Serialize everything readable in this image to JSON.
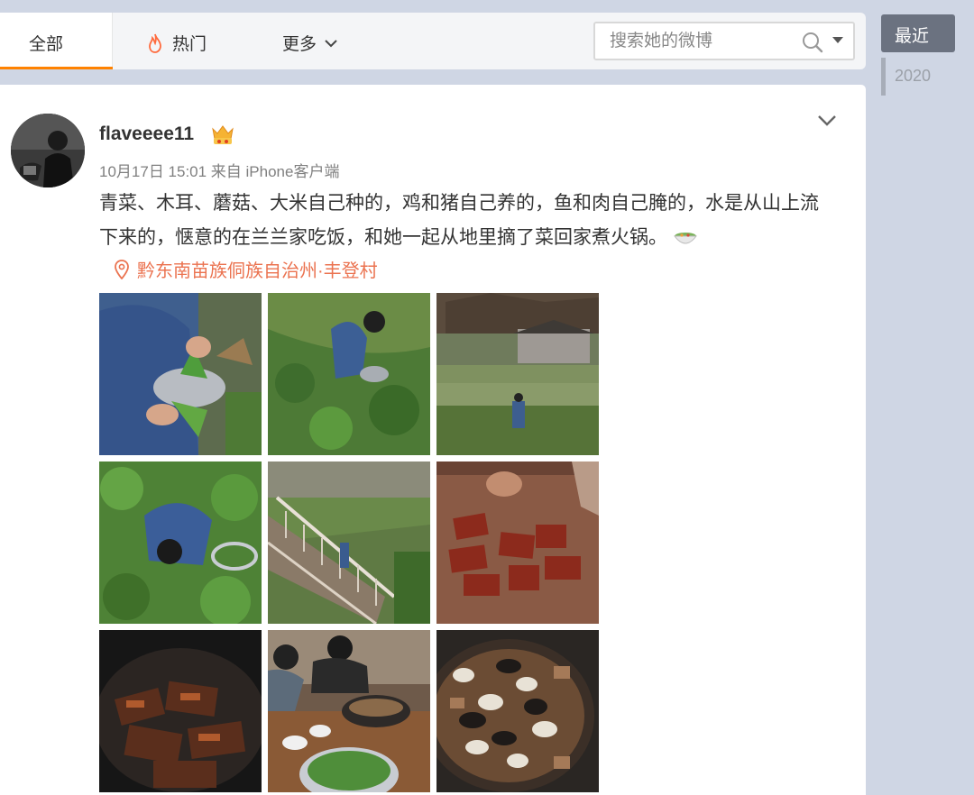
{
  "tabs": {
    "all_label": "全部",
    "hot_label": "热门",
    "more_label": "更多"
  },
  "search": {
    "placeholder": "搜索她的微博"
  },
  "timeline": {
    "current_label": "最近",
    "year": "2020"
  },
  "post": {
    "username": "flaveeee11",
    "meta": "10月17日 15:01 来自 iPhone客户端",
    "content": "青菜、木耳、蘑菇、大米自己种的，鸡和猪自己养的，鱼和肉自己腌的，水是从山上流下来的，惬意的在兰兰家吃饭，和她一起从地里摘了菜回家煮火锅。",
    "location": "黔东南苗族侗族自治州·丰登村",
    "photos": [
      "photo-greens-in-hand",
      "photo-picking-vegetables",
      "photo-village-terraces",
      "photo-bending-in-field",
      "photo-wooden-stairs",
      "photo-cured-meat",
      "photo-grilled-fish",
      "photo-dinner-table",
      "photo-hotpot"
    ]
  },
  "colors": {
    "accent": "#ff8200",
    "location": "#eb7350",
    "timeline_active": "#6b7280",
    "page_bg": "#cfd6e4"
  }
}
